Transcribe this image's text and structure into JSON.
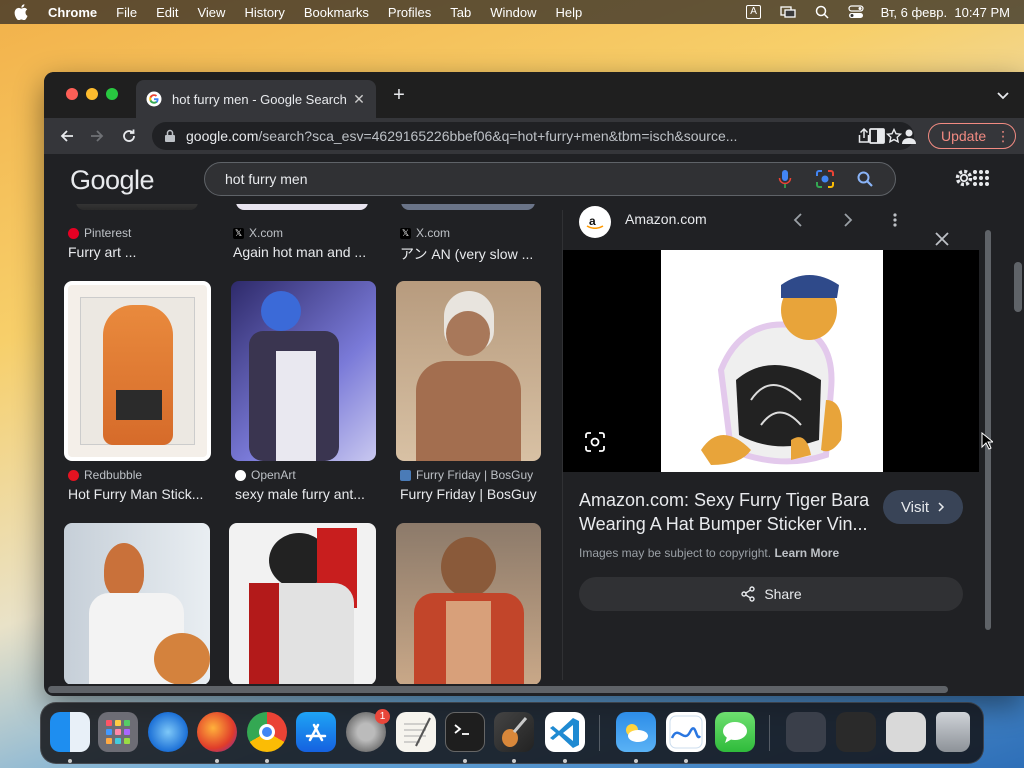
{
  "menubar": {
    "app": "Chrome",
    "items": [
      "File",
      "Edit",
      "View",
      "History",
      "Bookmarks",
      "Profiles",
      "Tab",
      "Window",
      "Help"
    ],
    "input_source": "A",
    "datetime": "Вт, 6 февр.  10:47 PM"
  },
  "browser": {
    "tab_title": "hot furry men - Google Search",
    "url_host": "google.com",
    "url_rest": "/search?sca_esv=4629165226bbef06&q=hot+furry+men&tbm=isch&source...",
    "update_label": "Update"
  },
  "google": {
    "logo": "Google",
    "query": "hot furry men"
  },
  "results": {
    "row0": [
      {
        "source": "Pinterest",
        "caption": "Furry art ...",
        "icon_color": "#e60023"
      },
      {
        "source": "X.com",
        "caption": "Again hot man and ...",
        "icon_color": "#000000"
      },
      {
        "source": "X.com",
        "caption": "アン AN (very slow ...",
        "icon_color": "#000000"
      }
    ],
    "row1": [
      {
        "source": "Redbubble",
        "caption": "Hot Furry Man Stick...",
        "icon_color": "#e41321"
      },
      {
        "source": "OpenArt",
        "caption": "sexy male furry ant...",
        "icon_color": "#ffffff"
      },
      {
        "source": "Furry Friday | BosGuy",
        "caption": "Furry Friday | BosGuy",
        "icon_color": "#4a7bb7"
      }
    ]
  },
  "preview": {
    "site": "Amazon.com",
    "title": "Amazon.com: Sexy Furry Tiger Bara Wearing A Hat Bumper Sticker Vin...",
    "visit_label": "Visit",
    "copyright": "Images may be subject to copyright.",
    "learn_more": "Learn More",
    "share_label": "Share"
  },
  "dock": {
    "settings_badge": "1"
  }
}
